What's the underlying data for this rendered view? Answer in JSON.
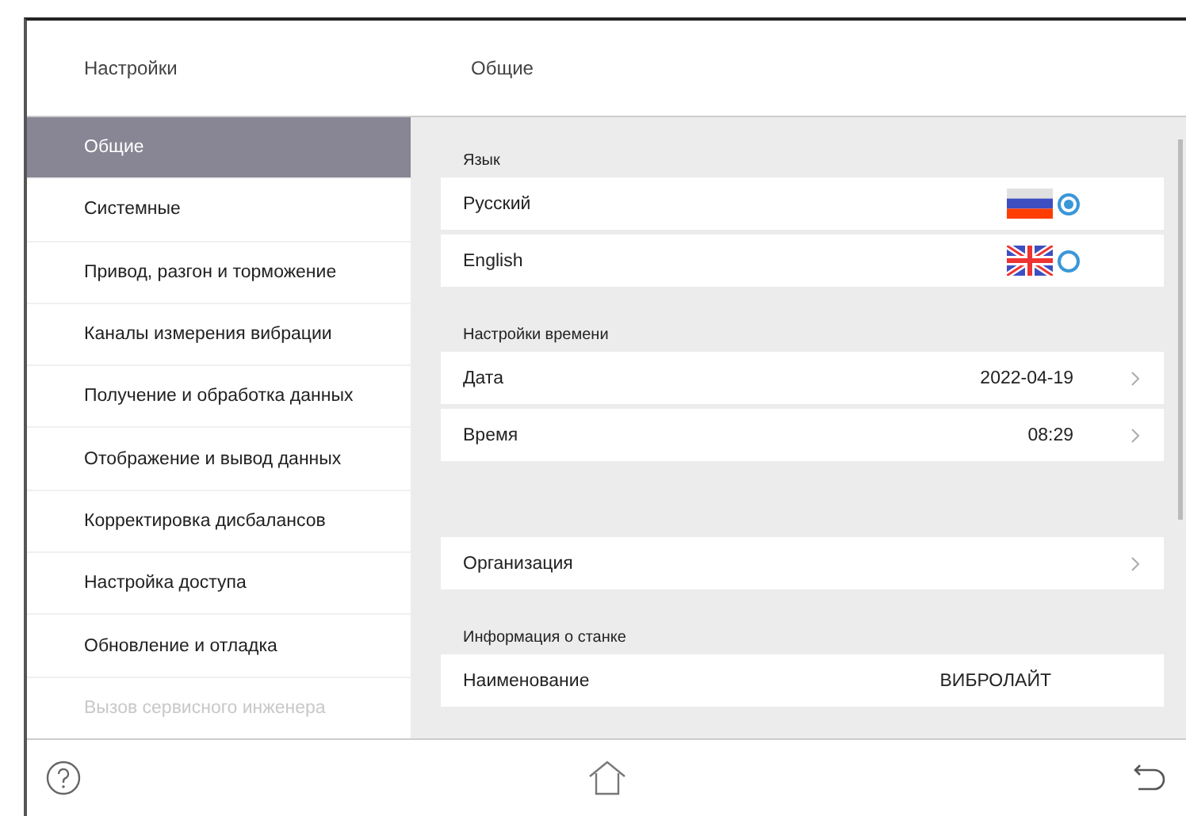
{
  "header": {
    "sidebar_title": "Настройки",
    "page_title": "Общие"
  },
  "sidebar": {
    "items": [
      {
        "label": "Общие",
        "selected": true,
        "disabled": false
      },
      {
        "label": "Системные",
        "selected": false,
        "disabled": false
      },
      {
        "label": "Привод, разгон и торможение",
        "selected": false,
        "disabled": false
      },
      {
        "label": "Каналы измерения вибрации",
        "selected": false,
        "disabled": false
      },
      {
        "label": "Получение и обработка данных",
        "selected": false,
        "disabled": false
      },
      {
        "label": "Отображение и вывод данных",
        "selected": false,
        "disabled": false
      },
      {
        "label": "Корректировка дисбалансов",
        "selected": false,
        "disabled": false
      },
      {
        "label": "Настройка доступа",
        "selected": false,
        "disabled": false
      },
      {
        "label": "Обновление и отладка",
        "selected": false,
        "disabled": false
      },
      {
        "label": "Вызов сервисного инженера",
        "selected": false,
        "disabled": true
      }
    ]
  },
  "sections": [
    {
      "label": "Язык",
      "rows": [
        {
          "kind": "radio",
          "label": "Русский",
          "selected": true
        },
        {
          "kind": "radio",
          "label": "English",
          "selected": false
        }
      ]
    },
    {
      "label": "Настройки времени",
      "rows": [
        {
          "kind": "link",
          "label": "Дата",
          "value": "2022-04-19"
        },
        {
          "kind": "link",
          "label": "Время",
          "value": "08:29"
        }
      ]
    },
    {
      "rows": [
        {
          "kind": "link",
          "label": "Организация"
        }
      ]
    },
    {
      "label": "Информация о станке",
      "rows": [
        {
          "kind": "info",
          "label": "Наименование",
          "value": "ВИБРОЛАЙТ"
        }
      ]
    }
  ]
}
